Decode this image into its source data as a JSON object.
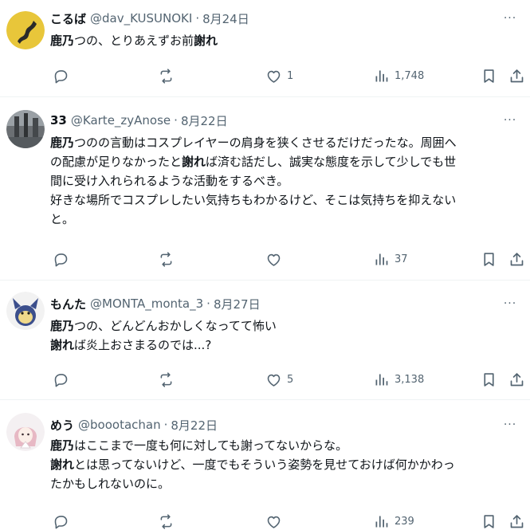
{
  "posts": [
    {
      "name": "こるば",
      "handle": "@dav_KUSUNOKI",
      "date": "8月24日",
      "lines": [
        [
          {
            "t": "鹿乃",
            "b": true
          },
          {
            "t": "つの、とりあえずお前"
          },
          {
            "t": "謝れ",
            "b": true
          }
        ]
      ],
      "replies": "",
      "retweets": "",
      "likes": "1",
      "views": "1,748"
    },
    {
      "name": "33",
      "handle": "@Karte_zyAnose",
      "date": "8月22日",
      "lines": [
        [
          {
            "t": "鹿乃",
            "b": true
          },
          {
            "t": "つのの言動はコスプレイヤーの肩身を狭くさせるだけだったな。周囲へ"
          }
        ],
        [
          {
            "t": "の配慮が足りなかったと"
          },
          {
            "t": "謝れ",
            "b": true
          },
          {
            "t": "ば済む話だし、誠実な態度を示して少しでも世"
          }
        ],
        [
          {
            "t": "間に受け入れられるような活動をするべき。"
          }
        ],
        [
          {
            "t": "好きな場所でコスプレしたい気持ちもわかるけど、そこは気持ちを抑えない"
          }
        ],
        [
          {
            "t": "と。"
          }
        ]
      ],
      "replies": "",
      "retweets": "",
      "likes": "",
      "views": "37"
    },
    {
      "name": "もんた",
      "handle": "@MONTA_monta_3",
      "date": "8月27日",
      "lines": [
        [
          {
            "t": "鹿乃",
            "b": true
          },
          {
            "t": "つの、どんどんおかしくなってて怖い"
          }
        ],
        [
          {
            "t": "謝れ",
            "b": true
          },
          {
            "t": "ば炎上おさまるのでは...?"
          }
        ]
      ],
      "replies": "",
      "retweets": "",
      "likes": "5",
      "views": "3,138"
    },
    {
      "name": "めう",
      "handle": "@boootachan",
      "date": "8月22日",
      "lines": [
        [
          {
            "t": "鹿乃",
            "b": true
          },
          {
            "t": "はここまで一度も何に対しても謝ってないからな。"
          }
        ],
        [
          {
            "t": "謝れ",
            "b": true
          },
          {
            "t": "とは思ってないけど、一度でもそういう姿勢を見せておけば何かかわっ"
          }
        ],
        [
          {
            "t": "たかもしれないのに。"
          }
        ]
      ],
      "replies": "",
      "retweets": "",
      "likes": "",
      "views": "239"
    }
  ],
  "ui": {
    "dot": "·",
    "more_glyph": "···"
  },
  "icons": {
    "more": "more-dots-icon",
    "reply": "reply-bubble-icon",
    "retweet": "retweet-arrows-icon",
    "like": "heart-outline-icon",
    "views": "views-bar-chart-icon",
    "bookmark": "bookmark-icon",
    "share": "share-upload-icon"
  },
  "colors": {
    "text": "#0f1419",
    "secondary": "#536471",
    "divider": "#eff3f4"
  }
}
